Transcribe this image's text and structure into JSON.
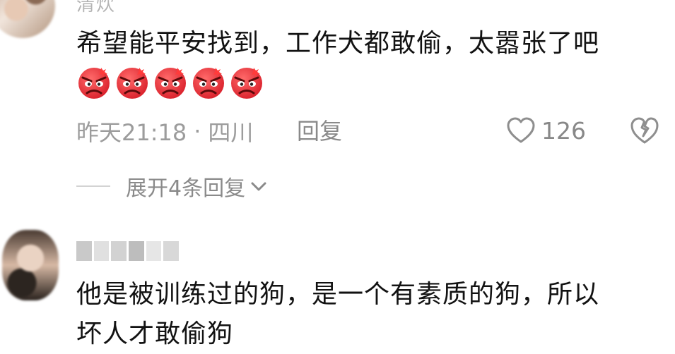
{
  "comment1": {
    "username": "清炊",
    "text": "希望能平安找到，工作犬都敢偷，太嚣张了吧",
    "emoji": [
      "angry-face-emoji",
      "angry-face-emoji",
      "angry-face-emoji",
      "angry-face-emoji",
      "angry-face-emoji"
    ],
    "time": "昨天21:18",
    "separator": "·",
    "location": "四川",
    "reply_label": "回复",
    "like_count": "126",
    "expand_label": "展开4条回复",
    "icons": {
      "like": "heart-outline-icon",
      "dislike": "broken-heart-icon",
      "expand": "chevron-down-icon"
    }
  },
  "comment2": {
    "text": "他是被训练过的狗，是一个有素质的狗，所以\n坏人才敢偷狗"
  },
  "colors": {
    "text_primary": "#121212",
    "text_secondary": "#9c9c9c",
    "emoji_red": "#e8333b"
  }
}
